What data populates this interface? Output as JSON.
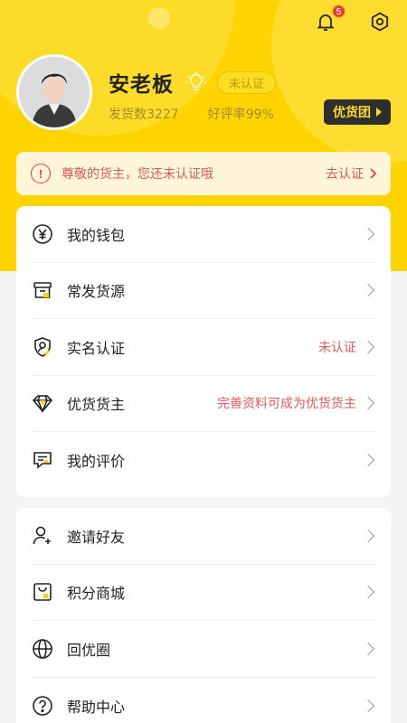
{
  "header": {
    "notification_count": "5"
  },
  "profile": {
    "name": "安老板",
    "cert_tag": "未认证",
    "shipments": "发货数3227",
    "rating": "好评率99%",
    "quality_button": "优货团"
  },
  "notice": {
    "text": "尊敬的货主，您还未认证哦",
    "action": "去认证"
  },
  "menu1": [
    {
      "label": "我的钱包",
      "value": "",
      "icon": "wallet-icon"
    },
    {
      "label": "常发货源",
      "value": "",
      "icon": "box-icon"
    },
    {
      "label": "实名认证",
      "value": "未认证",
      "icon": "shield-user-icon"
    },
    {
      "label": "优货货主",
      "value": "完善资料可成为优货货主",
      "icon": "diamond-icon"
    },
    {
      "label": "我的评价",
      "value": "",
      "icon": "comment-icon"
    }
  ],
  "menu2": [
    {
      "label": "邀请好友",
      "value": "",
      "icon": "add-user-icon"
    },
    {
      "label": "积分商城",
      "value": "",
      "icon": "shop-icon"
    },
    {
      "label": "回优圈",
      "value": "",
      "icon": "globe-icon"
    },
    {
      "label": "帮助中心",
      "value": "",
      "icon": "help-icon"
    }
  ],
  "colors": {
    "brand_yellow": "#fdd400",
    "alert_red": "#e8393e",
    "dark": "#2e2e2e"
  }
}
